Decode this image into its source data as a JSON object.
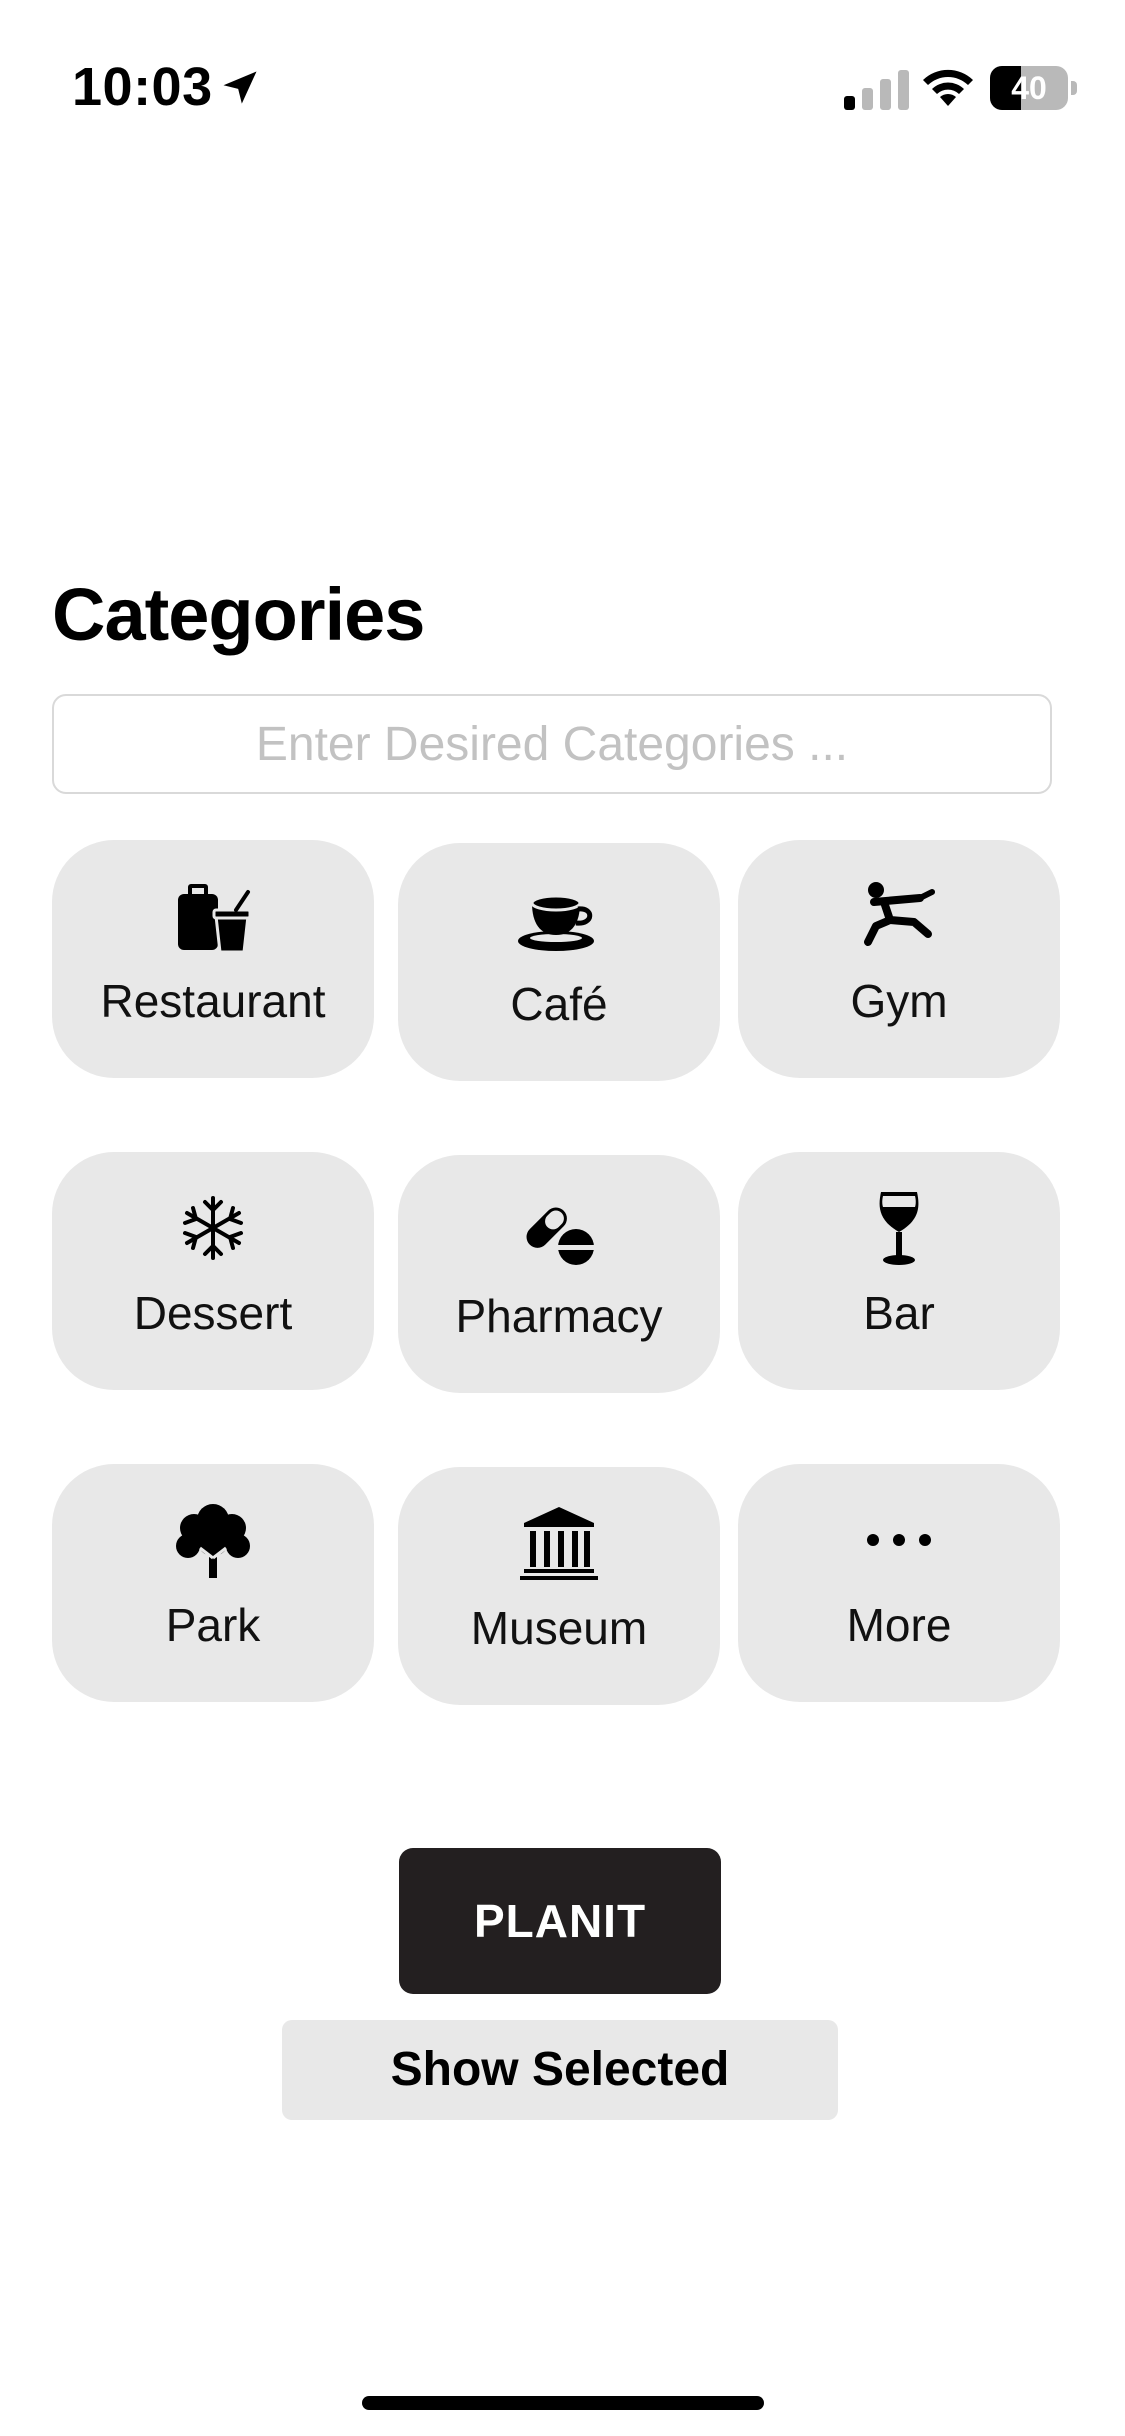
{
  "status_bar": {
    "time": "10:03",
    "battery_level": "40",
    "battery_fraction": 0.4,
    "signal_bars_active": 1,
    "signal_bars_total": 4
  },
  "title": "Categories",
  "search": {
    "value": "",
    "placeholder": "Enter Desired Categories ..."
  },
  "categories": [
    {
      "label": "Restaurant",
      "icon": "takeout-bag-icon"
    },
    {
      "label": "Café",
      "icon": "cup-and-saucer-icon"
    },
    {
      "label": "Gym",
      "icon": "figure-exercise-icon"
    },
    {
      "label": "Dessert",
      "icon": "snowflake-icon"
    },
    {
      "label": "Pharmacy",
      "icon": "pills-icon"
    },
    {
      "label": "Bar",
      "icon": "wine-glass-icon"
    },
    {
      "label": "Park",
      "icon": "tree-icon"
    },
    {
      "label": "Museum",
      "icon": "building-columns-icon"
    },
    {
      "label": "More",
      "icon": "ellipsis-icon"
    }
  ],
  "actions": {
    "planit_label": "PLANIT",
    "show_selected_label": "Show Selected"
  },
  "colors": {
    "tile_background": "#e8e8e8",
    "primary_button": "#231f20",
    "primary_button_text": "#ffffff",
    "placeholder": "#c2c2c2"
  }
}
